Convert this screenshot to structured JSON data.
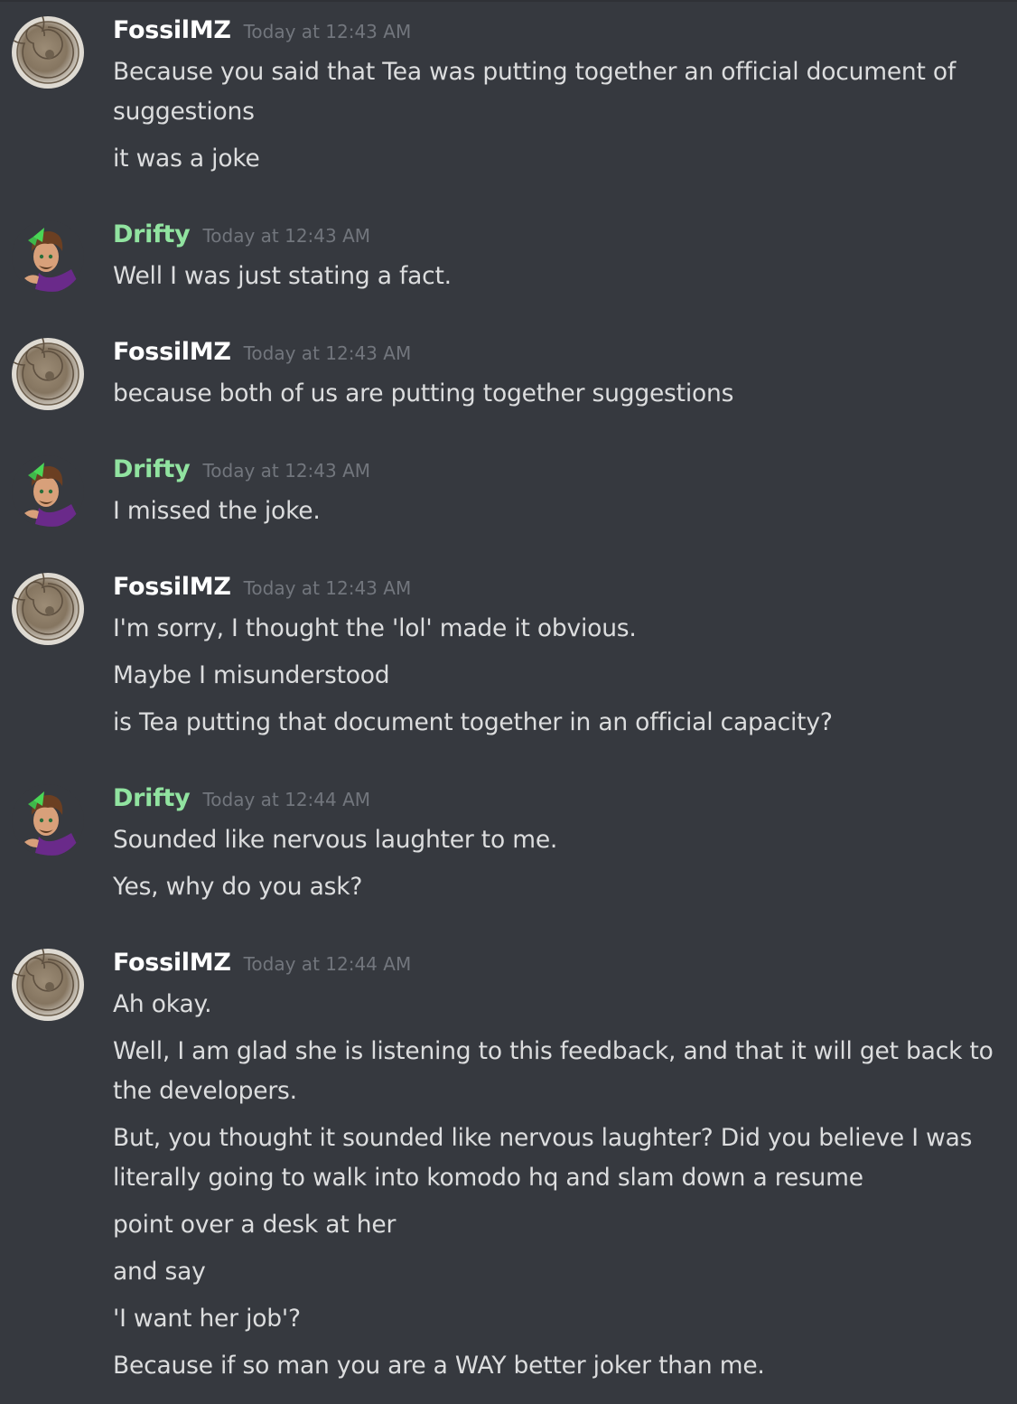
{
  "colors": {
    "background": "#36393f",
    "username_default": "#ffffff",
    "username_drifty": "#91e3a0",
    "timestamp": "#72767d",
    "message_text": "#dcddde"
  },
  "messages": [
    {
      "author": "FossilMZ",
      "avatar_icon": "ammonite-fossil-avatar",
      "timestamp": "Today at 12:43 AM",
      "lines": [
        "Because you said that Tea was putting together an official document of suggestions",
        "it was a joke"
      ]
    },
    {
      "author": "Drifty",
      "avatar_icon": "cartoon-character-avatar",
      "timestamp": "Today at 12:43 AM",
      "lines": [
        "Well I was just stating a fact."
      ]
    },
    {
      "author": "FossilMZ",
      "avatar_icon": "ammonite-fossil-avatar",
      "timestamp": "Today at 12:43 AM",
      "lines": [
        "because both of us are putting together suggestions"
      ]
    },
    {
      "author": "Drifty",
      "avatar_icon": "cartoon-character-avatar",
      "timestamp": "Today at 12:43 AM",
      "lines": [
        "I missed the joke."
      ]
    },
    {
      "author": "FossilMZ",
      "avatar_icon": "ammonite-fossil-avatar",
      "timestamp": "Today at 12:43 AM",
      "lines": [
        "I'm sorry, I thought the 'lol' made it obvious.",
        "Maybe I misunderstood",
        "is Tea putting that document together in an official capacity?"
      ]
    },
    {
      "author": "Drifty",
      "avatar_icon": "cartoon-character-avatar",
      "timestamp": "Today at 12:44 AM",
      "lines": [
        "Sounded like nervous laughter to me.",
        "Yes, why do you ask?"
      ]
    },
    {
      "author": "FossilMZ",
      "avatar_icon": "ammonite-fossil-avatar",
      "timestamp": "Today at 12:44 AM",
      "lines": [
        "Ah okay.",
        "Well, I am glad she is listening to this feedback, and that it will get back to the developers.",
        "But, you thought it sounded like nervous laughter?  Did you believe I was literally going to walk into komodo hq and slam down a resume",
        "point over a desk at her",
        "and say",
        "'I want her job'?",
        "Because if so man you are a WAY better joker than me."
      ]
    }
  ]
}
